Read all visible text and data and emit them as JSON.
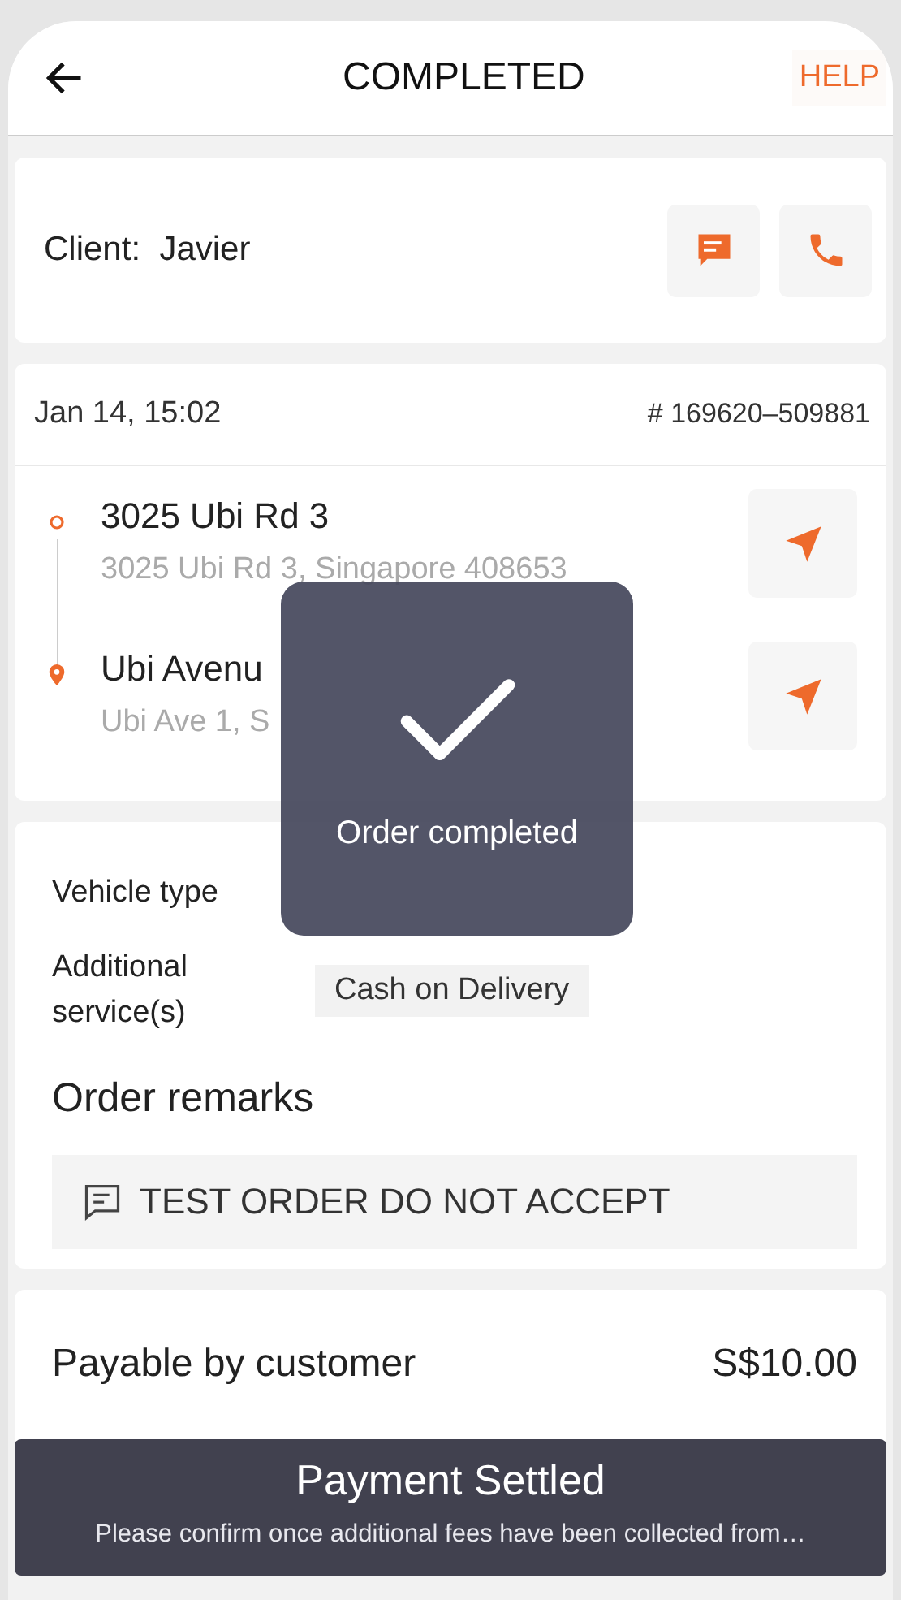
{
  "header": {
    "title": "COMPLETED",
    "help": "HELP"
  },
  "client": {
    "label": "Client:",
    "name": "Javier"
  },
  "order": {
    "time": "Jan 14, 15:02",
    "number": "# 169620–509881"
  },
  "stops": [
    {
      "kind": "pickup",
      "name": "3025 Ubi Rd 3",
      "address": "3025 Ubi Rd 3, Singapore 408653"
    },
    {
      "kind": "dropoff",
      "name": "Ubi Avenu",
      "address": "Ubi Ave 1, S"
    }
  ],
  "details": [
    {
      "label": "Vehicle type"
    },
    {
      "label": "Additional service(s)",
      "tag": "Cash on Delivery"
    }
  ],
  "remarks": {
    "title": "Order remarks",
    "text": "TEST ORDER DO NOT ACCEPT"
  },
  "payment": {
    "label": "Payable by customer",
    "amount": "S$10.00"
  },
  "toast": {
    "text": "Order completed"
  },
  "banner": {
    "title": "Payment Settled",
    "message": "Please confirm once additional fees have been collected from…"
  }
}
